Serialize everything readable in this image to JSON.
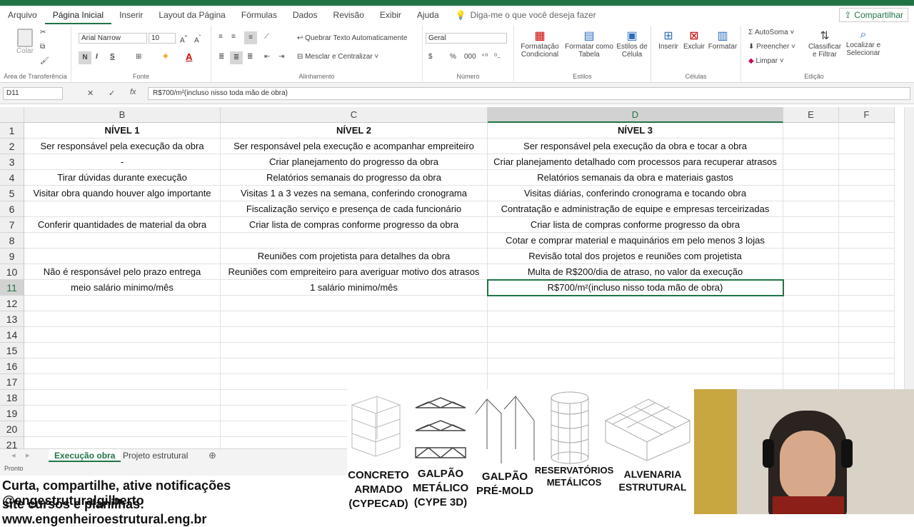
{
  "ribbon_tabs": [
    "Arquivo",
    "Página Inicial",
    "Inserir",
    "Layout da Página",
    "Fórmulas",
    "Dados",
    "Revisão",
    "Exibir",
    "Ajuda"
  ],
  "tell_me": "Diga-me o que você deseja fazer",
  "share_label": "Compartilhar",
  "clipboard": {
    "paste": "Colar",
    "label": "Área de Transferência"
  },
  "font": {
    "name": "Arial Narrow",
    "size": "10",
    "bold": "N",
    "italic": "I",
    "underline": "S",
    "label": "Fonte"
  },
  "alignment": {
    "wrap": "Quebrar Texto Automaticamente",
    "merge": "Mesclar e Centralizar",
    "label": "Alinhamento"
  },
  "number": {
    "format": "Geral",
    "currency": "$",
    "percent": "%",
    "thousands": "000",
    "label": "Número"
  },
  "styles": {
    "cond": "Formatação Condicional",
    "table": "Formatar como Tabela",
    "cell": "Estilos de Célula",
    "label": "Estilos"
  },
  "cells": {
    "insert": "Inserir",
    "delete": "Excluir",
    "format": "Formatar",
    "label": "Células"
  },
  "editing": {
    "autosum": "AutoSoma",
    "fill": "Preencher",
    "clear": "Limpar",
    "sort": "Classificar e Filtrar",
    "find": "Localizar e Selecionar",
    "label": "Edição"
  },
  "name_box": "D11",
  "formula_value": "R$700/m²(incluso nisso toda mão de obra)",
  "columns": [
    "B",
    "C",
    "D",
    "E",
    "F"
  ],
  "rows": [
    "1",
    "2",
    "3",
    "4",
    "5",
    "6",
    "7",
    "8",
    "9",
    "10",
    "11",
    "12",
    "13",
    "14",
    "15",
    "16",
    "17",
    "18",
    "19",
    "20",
    "21"
  ],
  "table": [
    [
      "NÍVEL 1",
      "NÍVEL 2",
      "NÍVEL 3"
    ],
    [
      "Ser responsável pela execução da obra",
      "Ser responsável pela execução e acompanhar empreiteiro",
      "Ser responsável pela execução da obra e tocar a obra"
    ],
    [
      "-",
      "Criar planejamento do progresso da obra",
      "Criar planejamento detalhado com processos para recuperar atrasos"
    ],
    [
      "Tirar dúvidas durante execução",
      "Relatórios semanais do progresso da obra",
      "Relatórios semanais da obra e materiais gastos"
    ],
    [
      "Visitar obra quando houver algo importante",
      "Visitas 1 a 3 vezes na semana, conferindo cronograma",
      "Visitas diárias, conferindo cronograma e tocando obra"
    ],
    [
      "",
      "Fiscalização serviço e presença de cada funcionário",
      "Contratação e administração de equipe e empresas terceirizadas"
    ],
    [
      "Conferir quantidades de material da obra",
      "Criar lista de compras conforme progresso da obra",
      "Criar lista de compras conforme progresso da obra"
    ],
    [
      "",
      "",
      "Cotar e comprar material e maquinários em pelo menos 3 lojas"
    ],
    [
      "",
      "Reuniões com projetista para detalhes da obra",
      "Revisão total dos projetos e reuniões com projetista"
    ],
    [
      "Não é responsável pelo prazo entrega",
      "Reuniões com empreiteiro para averiguar motivo dos atrasos",
      "Multa de R$200/dia de atraso, no valor da execução"
    ],
    [
      "meio salário minimo/mês",
      "1 salário minimo/mês",
      "R$700/m²(incluso nisso toda mão de obra)"
    ]
  ],
  "sheets": [
    "Execução obra",
    "Projeto estrutural"
  ],
  "status": "Pronto",
  "promo": {
    "line1": "Curta, compartilhe, ative notificações @engestruturalgilberto",
    "line2": "site cursos e planilhas: www.engenheiroestrutural.eng.br"
  },
  "products": [
    {
      "l1": "CONCRETO",
      "l2": "ARMADO",
      "l3": "(CYPECAD)"
    },
    {
      "l1": "GALPÃO",
      "l2": "METÁLICO",
      "l3": "(CYPE 3D)"
    },
    {
      "l1": "GALPÃO",
      "l2": "PRÉ-MOLD",
      "l3": ""
    },
    {
      "l1": "RESERVATÓRIOS",
      "l2": "METÁLICOS",
      "l3": ""
    },
    {
      "l1": "ALVENARIA",
      "l2": "ESTRUTURAL",
      "l3": ""
    }
  ],
  "colors": {
    "accent": "#217346"
  }
}
